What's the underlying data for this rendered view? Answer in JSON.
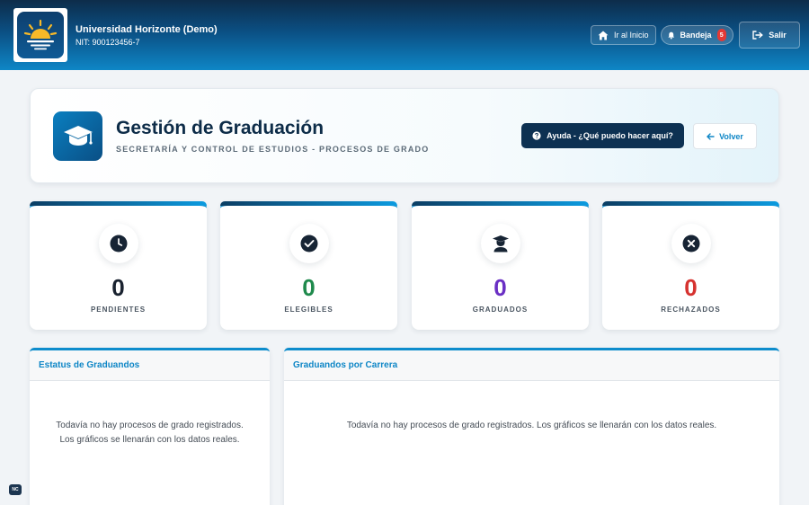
{
  "app": {
    "name": "Universidad Horizonte (Demo)",
    "nit": "NIT: 900123456-7"
  },
  "topbar": {
    "home_label": "Ir al Inicio",
    "inbox_label": "Bandeja",
    "inbox_count": "5",
    "exit_label": "Salir"
  },
  "header": {
    "title": "Gestión de Graduación",
    "subtitle": "SECRETARÍA Y CONTROL DE ESTUDIOS - PROCESOS DE GRADO",
    "help_label": "Ayuda - ¿Qué puedo hacer aquí?",
    "back_label": "Volver"
  },
  "stats": [
    {
      "value": "0",
      "label": "PENDIENTES",
      "icon": "clock-icon",
      "color": "#1a2330"
    },
    {
      "value": "0",
      "label": "ELEGIBLES",
      "icon": "check-circle-icon",
      "color": "#1f8a4c"
    },
    {
      "value": "0",
      "label": "GRADUADOS",
      "icon": "graduate-icon",
      "color": "#6a2fc4"
    },
    {
      "value": "0",
      "label": "RECHAZADOS",
      "icon": "x-circle-icon",
      "color": "#d6322f"
    }
  ],
  "panels": {
    "status": {
      "title": "Estatus de Graduandos",
      "empty": "Todavía no hay procesos de grado registrados. Los gráficos se llenarán con los datos reales."
    },
    "career": {
      "title": "Graduandos por Carrera",
      "empty": "Todavía no hay procesos de grado registrados. Los gráficos se llenarán con los datos reales."
    }
  },
  "footer_badge": "NC",
  "colors": {
    "accent": "#0e86c6",
    "navy": "#0d3152"
  }
}
